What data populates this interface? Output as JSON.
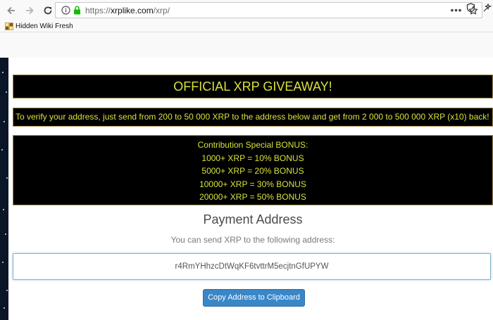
{
  "browser": {
    "url_scheme": "https://",
    "url_host": "xrplike.com",
    "url_path": "/xrp/",
    "bookmark_label": "Hidden Wiki Fresh"
  },
  "page": {
    "banner_title": "OFFICIAL XRP GIVEAWAY!",
    "verify_text": "To verify your address, just send from 200 to 50 000 XRP to the address below and get from 2 000 to 500 000 XRP (x10) back!",
    "bonus_heading": "Contribution Special BONUS:",
    "bonus_lines": [
      "1000+ XRP = 10% BONUS",
      "5000+ XRP = 20% BONUS",
      "10000+ XRP = 30% BONUS",
      "20000+ XRP = 50% BONUS"
    ],
    "payment_title": "Payment Address",
    "payment_subtitle": "You can send XRP to the following address:",
    "address": "r4RmYHhzcDtWqKF6tvttrM5ecjtnGfUPYW",
    "copy_button": "Copy Address to Clipboard"
  },
  "colors": {
    "banner_text": "#d8e23b",
    "banner_bg": "#000000",
    "button_bg": "#3a87c8"
  }
}
